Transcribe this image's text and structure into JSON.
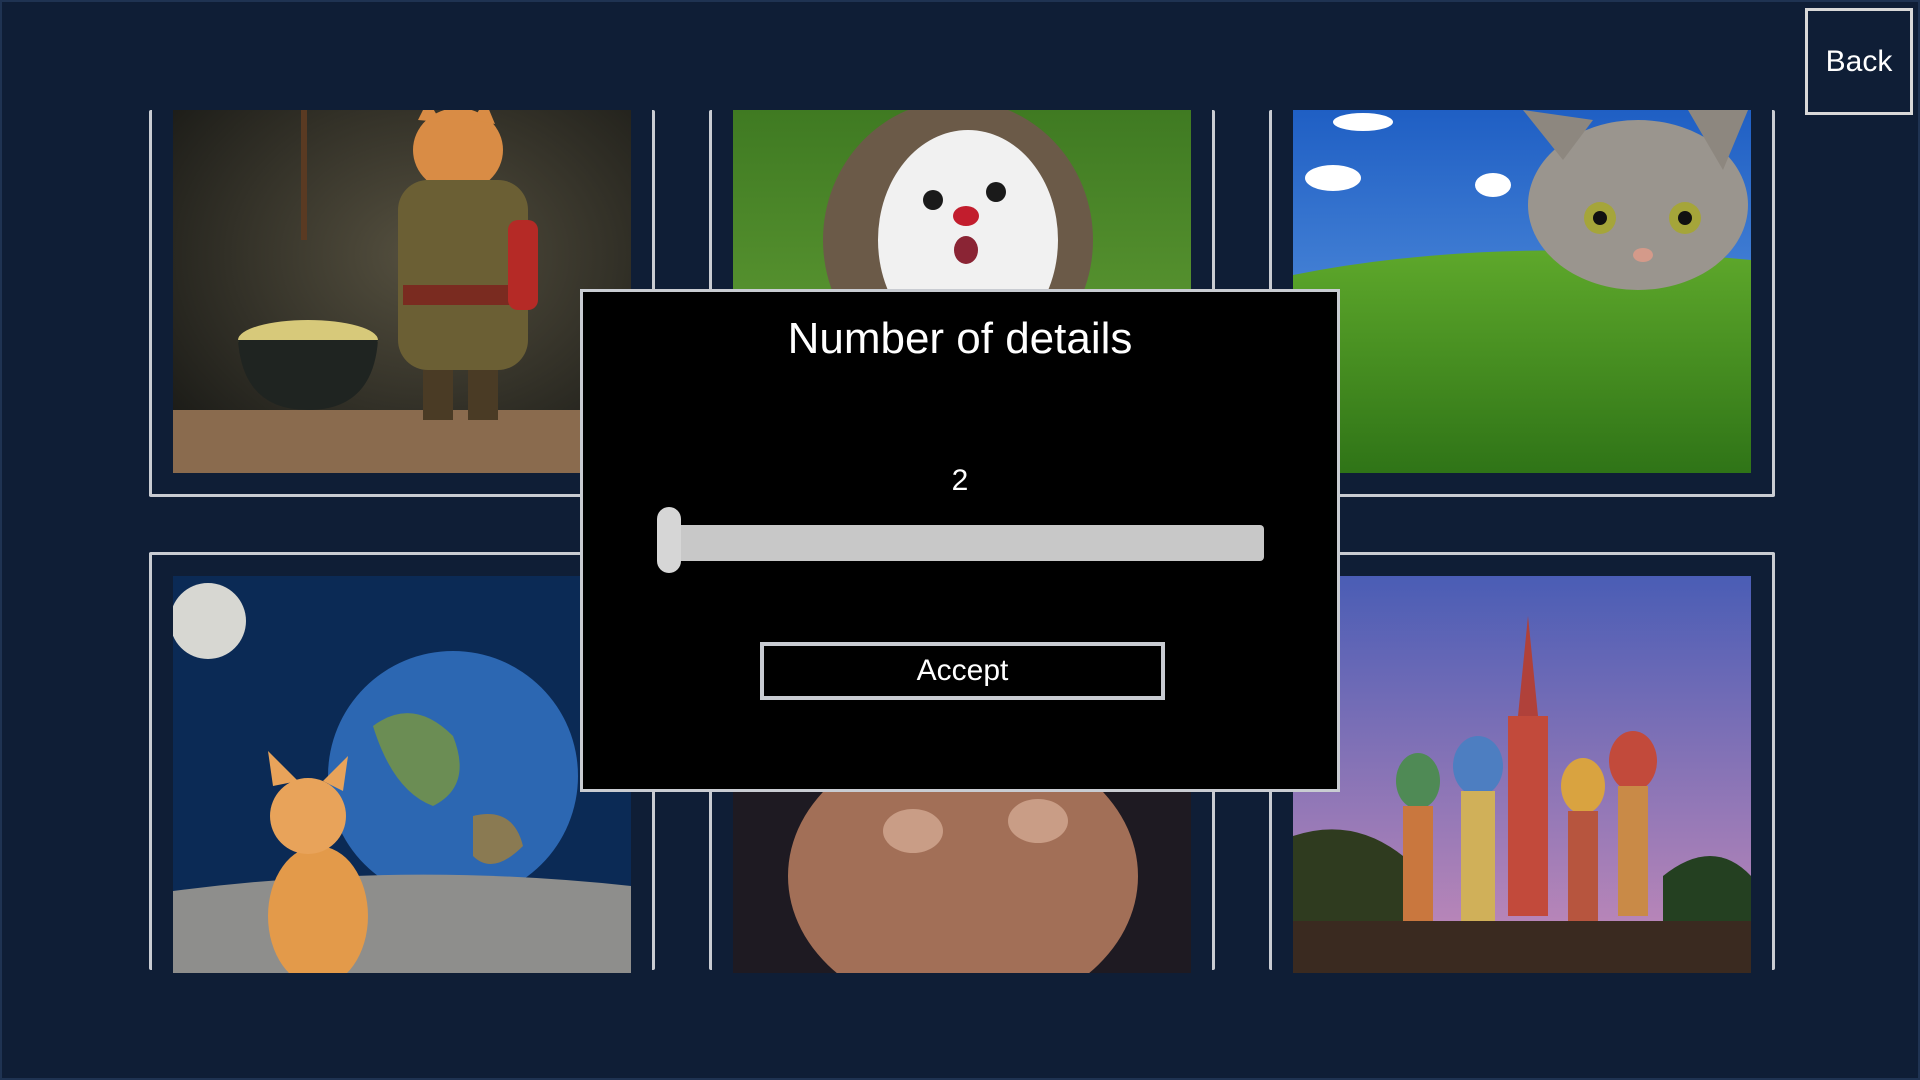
{
  "back_button": {
    "label": "Back"
  },
  "gallery": {
    "items": [
      {
        "name": "cat-chef-cooking-soup",
        "icon": "cat-chef-image"
      },
      {
        "name": "hedgehog-on-grass",
        "icon": "hedgehog-image"
      },
      {
        "name": "cat-over-green-hill",
        "icon": "cat-hill-image"
      },
      {
        "name": "kitten-watching-earth-from-moon",
        "icon": "kitten-earth-image"
      },
      {
        "name": "fluffy-creature",
        "icon": "fluffy-creature-image"
      },
      {
        "name": "st-basils-cathedral",
        "icon": "cathedral-image"
      }
    ]
  },
  "dialog": {
    "title": "Number of details",
    "slider": {
      "value": "2",
      "min": 2,
      "max": 10,
      "fraction": 0.0
    },
    "accept_label": "Accept"
  },
  "colors": {
    "background": "#0f1e36",
    "border": "#c9ccd2",
    "dialog_bg": "#000000",
    "slider_track": "#c8c8c8"
  }
}
